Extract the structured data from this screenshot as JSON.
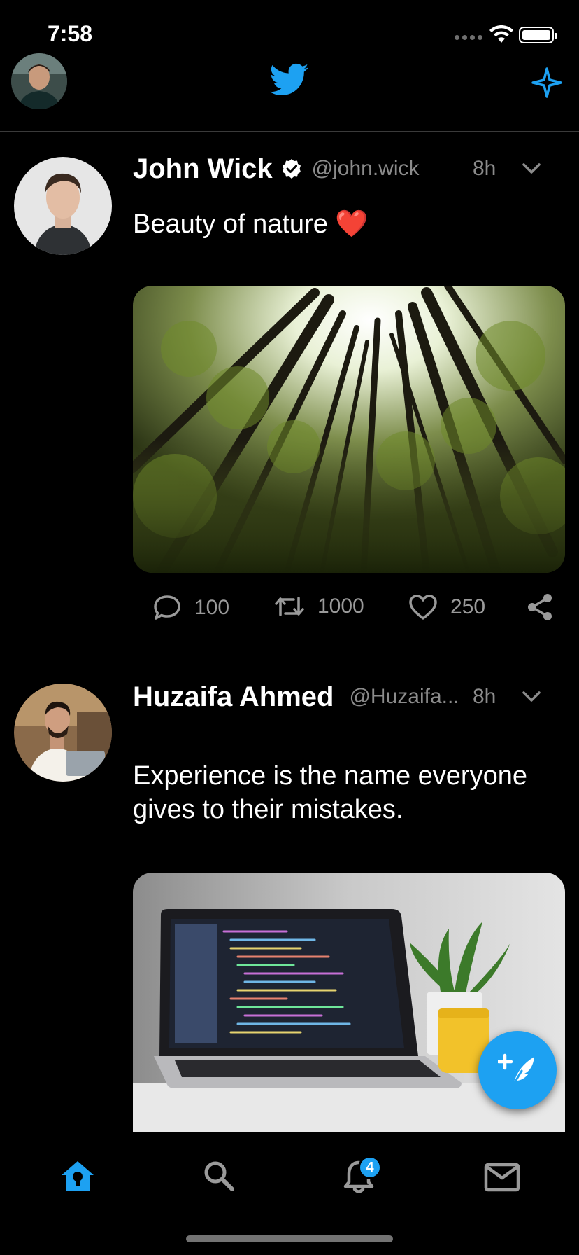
{
  "status_bar": {
    "time": "7:58"
  },
  "header": {
    "avatar": "profile-avatar",
    "logo": "twitter-bird-icon",
    "action": "sparkle-icon"
  },
  "colors": {
    "accent": "#1da1f2",
    "background": "#000000",
    "secondary_text": "#8b8b8b"
  },
  "tweets": [
    {
      "name": "John Wick",
      "verified": true,
      "handle": "@john.wick",
      "time": "8h",
      "text": "Beauty of nature ❤️",
      "media": "forest-photo",
      "replies": "100",
      "retweets": "1000",
      "likes": "250"
    },
    {
      "name": "Huzaifa Ahmed",
      "verified": false,
      "handle": "@Huzaifa...",
      "time": "8h",
      "text": "Experience is the name everyone gives to their mistakes.",
      "media": "laptop-photo"
    }
  ],
  "tab_bar": {
    "items": [
      "home-icon",
      "search-icon",
      "notifications-icon",
      "messages-icon"
    ],
    "notifications_badge": "4"
  }
}
